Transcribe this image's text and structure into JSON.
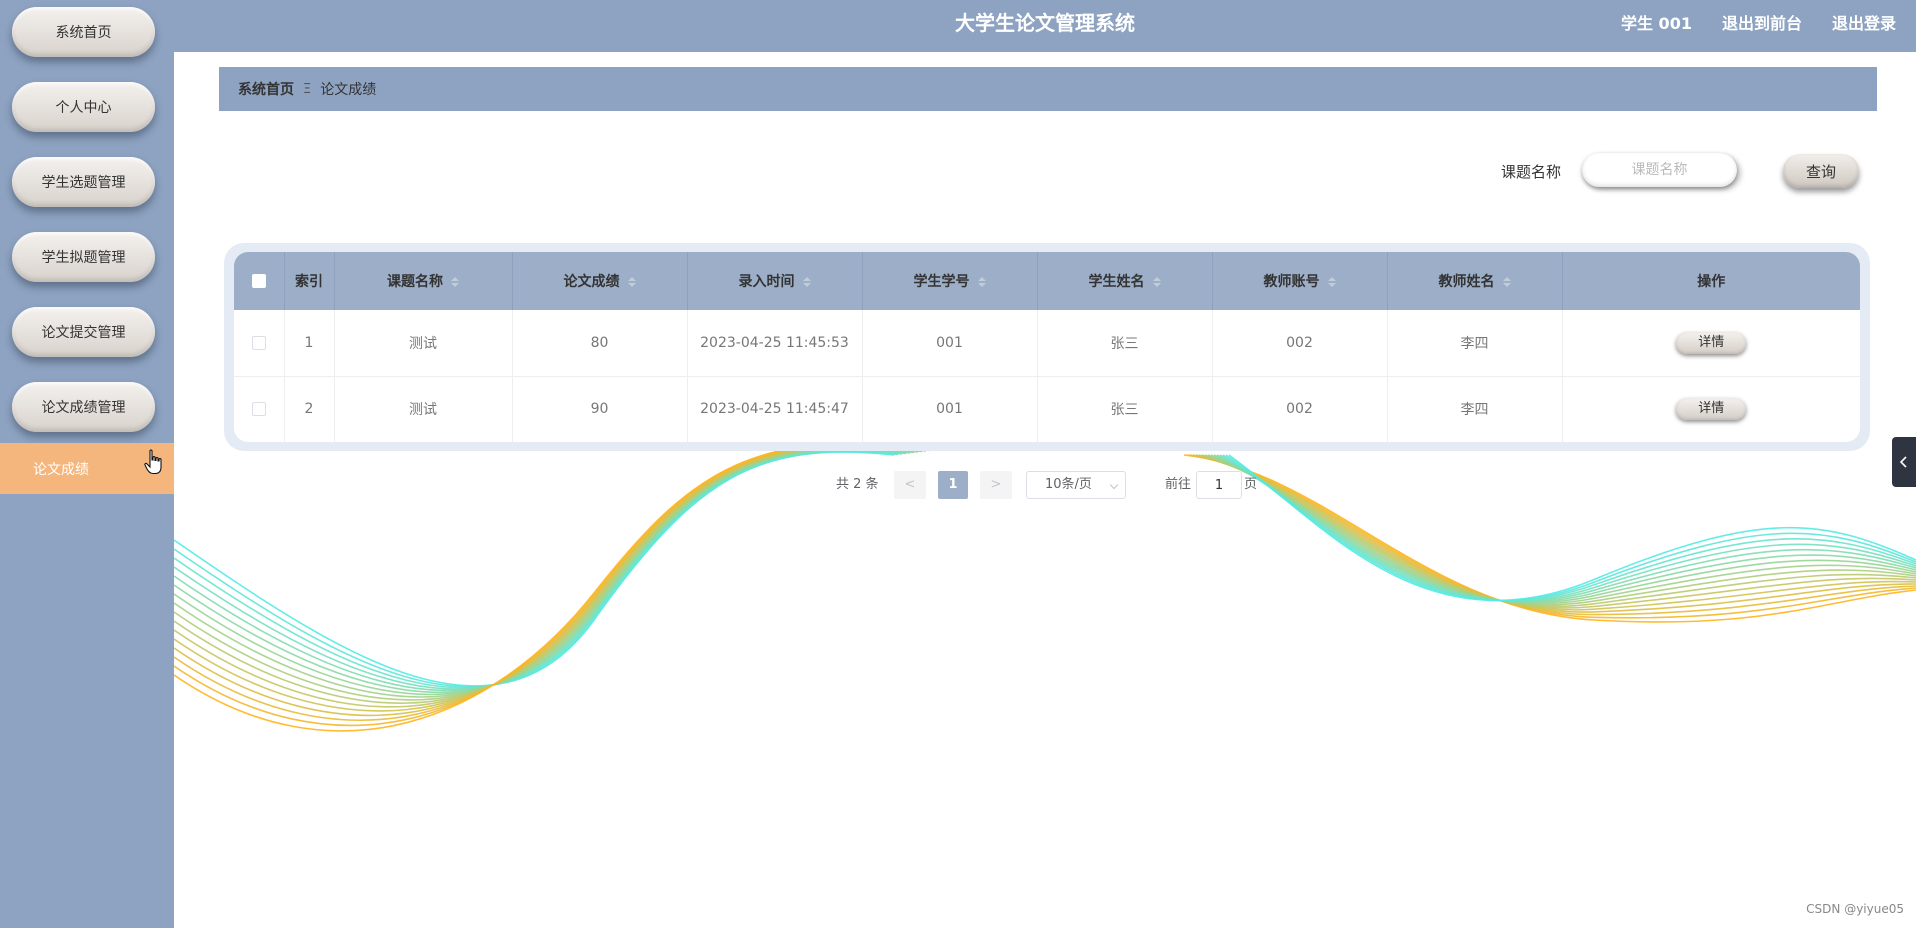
{
  "header": {
    "title": "大学生论文管理系统",
    "user": "学生 001",
    "back_to_front": "退出到前台",
    "logout": "退出登录"
  },
  "sidebar": {
    "items": [
      {
        "label": "系统首页"
      },
      {
        "label": "个人中心"
      },
      {
        "label": "学生选题管理"
      },
      {
        "label": "学生拟题管理"
      },
      {
        "label": "论文提交管理"
      },
      {
        "label": "论文成绩管理"
      }
    ],
    "active_sub": "论文成绩"
  },
  "breadcrumb": {
    "home": "系统首页",
    "separator": "Ξ",
    "current": "论文成绩"
  },
  "search": {
    "label": "课题名称",
    "placeholder": "课题名称",
    "value": "",
    "button": "查询"
  },
  "table": {
    "columns": [
      "索引",
      "课题名称",
      "论文成绩",
      "录入时间",
      "学生学号",
      "学生姓名",
      "教师账号",
      "教师姓名",
      "操作"
    ],
    "rows": [
      {
        "index": "1",
        "topic": "测试",
        "score": "80",
        "time": "2023-04-25 11:45:53",
        "student_no": "001",
        "student_name": "张三",
        "teacher_account": "002",
        "teacher_name": "李四",
        "action": "详情"
      },
      {
        "index": "2",
        "topic": "测试",
        "score": "90",
        "time": "2023-04-25 11:45:47",
        "student_no": "001",
        "student_name": "张三",
        "teacher_account": "002",
        "teacher_name": "李四",
        "action": "详情"
      }
    ]
  },
  "pagination": {
    "total": "共 2 条",
    "prev": "<",
    "current": "1",
    "next": ">",
    "page_size": "10条/页",
    "goto_label": "前往",
    "goto_value": "1",
    "page_unit": "页"
  },
  "watermark": "CSDN @yiyue05",
  "colors": {
    "primary": "#8da3c1",
    "table_header": "#9dafc8",
    "active_sub": "#f4b67c"
  }
}
